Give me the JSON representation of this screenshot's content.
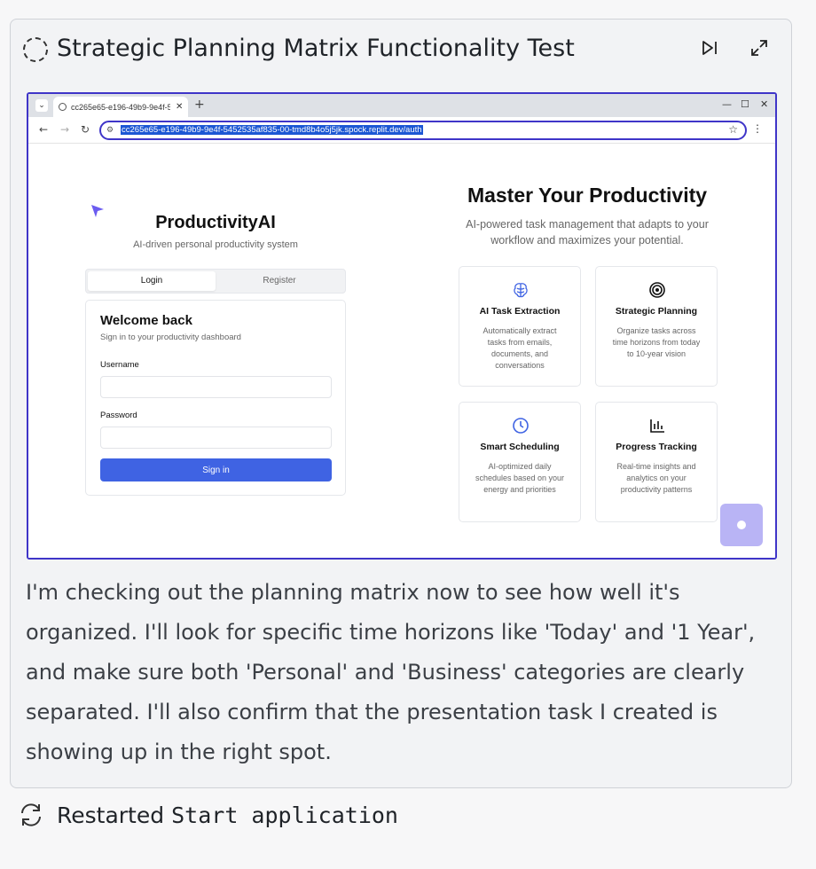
{
  "card": {
    "title": "Strategic Planning Matrix Functionality Test",
    "actions": [
      {
        "icon": "skip-to-end-icon"
      },
      {
        "icon": "expand-icon"
      }
    ]
  },
  "browser": {
    "tab_title": "cc265e65-e196-49b9-9e4f-54",
    "url": "cc265e65-e196-49b9-9e4f-5452535af835-00-tmd8b4o5j5jk.spock.replit.dev/auth",
    "controls": {
      "back": "←",
      "forward": "→",
      "reload": "↻",
      "new_tab": "+",
      "minimize": "—",
      "maximize": "☐",
      "close": "✕",
      "star": "☆",
      "menu": "⋮",
      "tab_close": "✕",
      "chevron": "⌄"
    }
  },
  "app": {
    "brand": "ProductivityAI",
    "brand_sub": "AI-driven personal productivity system",
    "tabs": [
      {
        "label": "Login",
        "active": true
      },
      {
        "label": "Register",
        "active": false
      }
    ],
    "login": {
      "title": "Welcome back",
      "subtitle": "Sign in to your productivity dashboard",
      "username_label": "Username",
      "username_value": "",
      "password_label": "Password",
      "password_value": "",
      "submit": "Sign in"
    },
    "hero": {
      "title": "Master Your Productivity",
      "subtitle": "AI-powered task management that adapts to your workflow and maximizes your potential."
    },
    "features": [
      {
        "icon": "brain-icon",
        "title": "AI Task Extraction",
        "desc": "Automatically extract tasks from emails, documents, and conversations"
      },
      {
        "icon": "target-icon",
        "title": "Strategic Planning",
        "desc": "Organize tasks across time horizons from today to 10-year vision"
      },
      {
        "icon": "clock-icon",
        "title": "Smart Scheduling",
        "desc": "AI-optimized daily schedules based on your energy and priorities"
      },
      {
        "icon": "bar-chart-icon",
        "title": "Progress Tracking",
        "desc": "Real-time insights and analytics on your productivity patterns"
      }
    ],
    "accent": "#3f63e3"
  },
  "description": "I'm checking out the planning matrix now to see how well it's organized. I'll look for specific time horizons like 'Today' and '1 Year', and make sure both 'Personal' and 'Business' categories are clearly separated. I'll also confirm that the presentation task I created is showing up in the right spot.",
  "status": {
    "label": "Restarted",
    "code": "Start application",
    "icon": "restart-icon"
  }
}
